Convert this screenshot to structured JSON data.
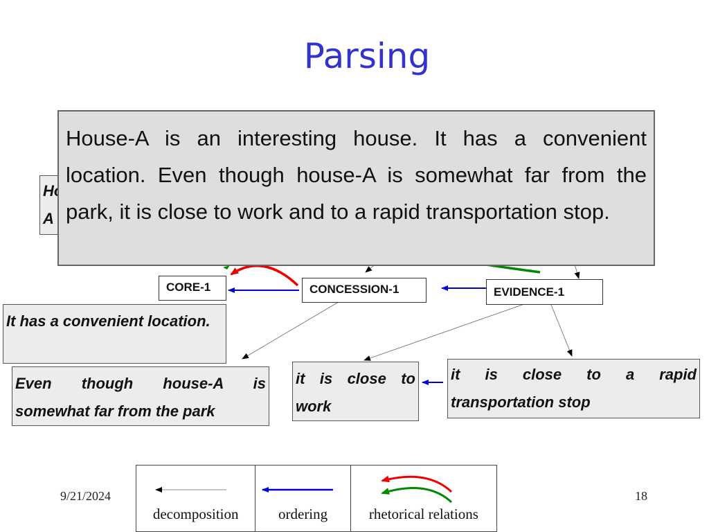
{
  "slide": {
    "title": "Parsing",
    "date": "9/21/2024",
    "page_number": "18"
  },
  "overlay_text": "House-A is an interesting house. It has a convenient location. Even though house-A is somewhat far from the park, it is close  to work and to a rapid transportation stop.",
  "hidden_box": {
    "text": "House-A is an interesting house."
  },
  "nodes": {
    "core": "CORE-1",
    "concession": "CONCESSION-1",
    "evidence": "EVIDENCE-1"
  },
  "leaves": {
    "convenient": "It has a convenient location.",
    "even_though": "Even though house-A is somewhat far from the park",
    "close_work": "it is close  to work",
    "close_transport": "it is close  to a rapid transportation stop"
  },
  "legend": {
    "items": [
      {
        "label": "decomposition",
        "color": "#000000"
      },
      {
        "label": "ordering",
        "color": "#0000dd"
      },
      {
        "label": "rhetorical relations",
        "colors": [
          "#ee0000",
          "#008800"
        ]
      }
    ]
  },
  "colors": {
    "title": "#3333cc",
    "ordering": "#0000dd",
    "rhetorical_red": "#ee0000",
    "rhetorical_green": "#008800"
  }
}
